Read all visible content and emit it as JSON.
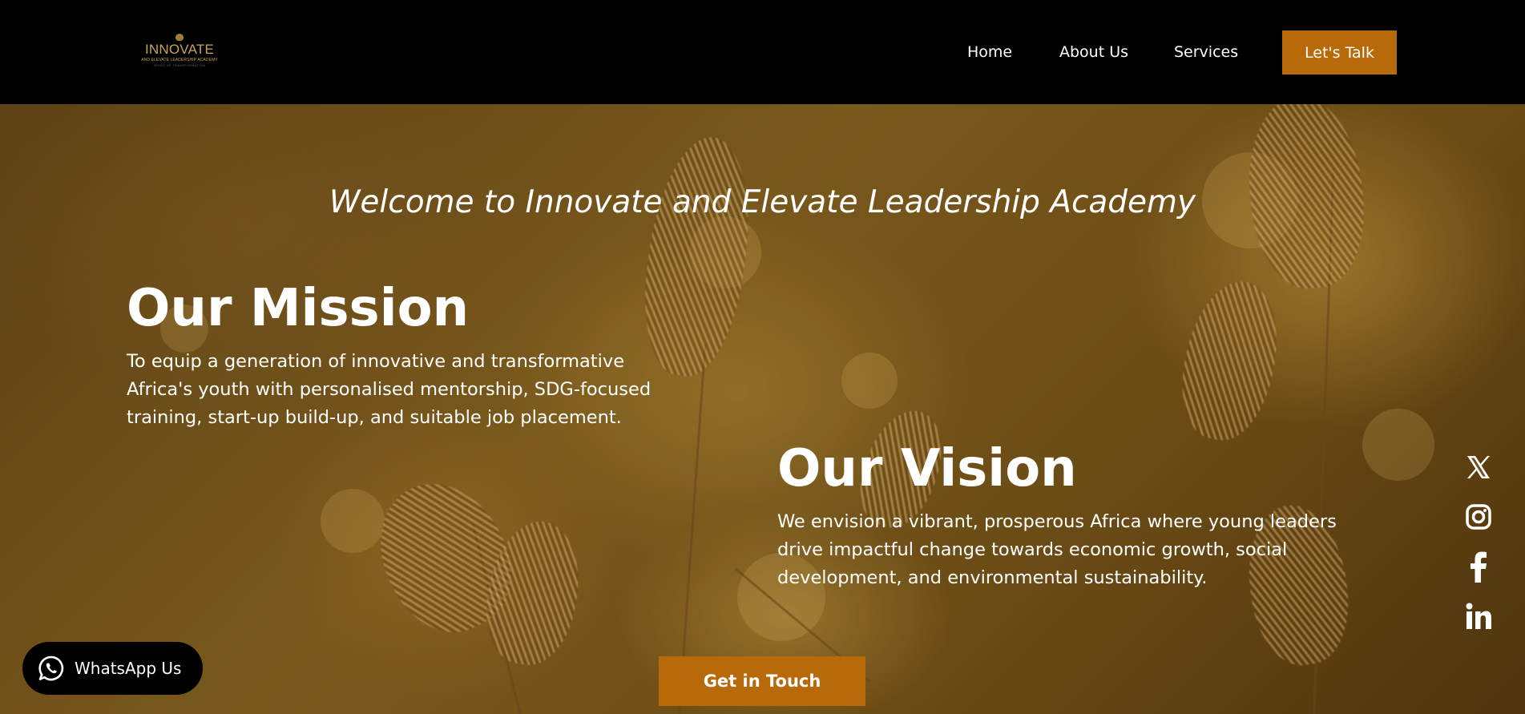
{
  "header": {
    "logo": {
      "icon": "crest-icon",
      "title": "INNOVATE",
      "subtitle": "AND ELEVATE LEADERSHIP ACADEMY",
      "tagline": "SEEDS OF TRANSFORMATION"
    },
    "nav": [
      {
        "label": "Home"
      },
      {
        "label": "About Us"
      },
      {
        "label": "Services"
      }
    ],
    "cta_label": "Let's Talk"
  },
  "hero": {
    "welcome": "Welcome to Innovate and Elevate Leadership Academy",
    "mission": {
      "heading": "Our Mission",
      "text": "To equip a generation of innovative and transformative Africa's youth with personalised mentorship, SDG-focused training, start-up build-up, and suitable job placement."
    },
    "vision": {
      "heading": "Our Vision",
      "text": "We envision a vibrant, prosperous Africa where young leaders drive impactful change towards economic growth, social development, and environmental sustainability."
    },
    "cta_label": "Get in Touch"
  },
  "social": [
    {
      "icon": "x-icon"
    },
    {
      "icon": "instagram-icon"
    },
    {
      "icon": "facebook-icon"
    },
    {
      "icon": "linkedin-icon"
    }
  ],
  "whatsapp": {
    "icon": "whatsapp-icon",
    "label": "WhatsApp Us"
  },
  "colors": {
    "accent": "#b8690a",
    "header_bg": "#000000",
    "text": "#ffffff"
  }
}
